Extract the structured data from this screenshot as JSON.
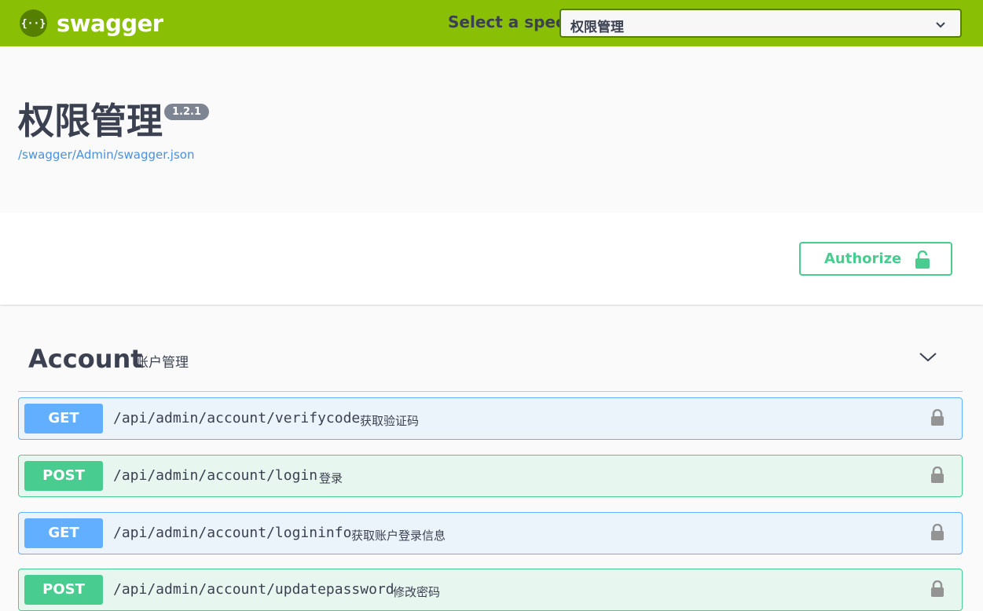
{
  "topbar": {
    "brand": "swagger",
    "spec_label": "Select a spec",
    "spec_selected": "权限管理"
  },
  "info": {
    "title": "权限管理",
    "version": "1.2.1",
    "url": "/swagger/Admin/swagger.json"
  },
  "authorize": {
    "label": "Authorize"
  },
  "tag": {
    "name": "Account",
    "description": "账户管理"
  },
  "operations": [
    {
      "method": "GET",
      "path": "/api/admin/account/verifycode",
      "summary": "获取验证码"
    },
    {
      "method": "POST",
      "path": "/api/admin/account/login",
      "summary": "登录"
    },
    {
      "method": "GET",
      "path": "/api/admin/account/logininfo",
      "summary": "获取账户登录信息"
    },
    {
      "method": "POST",
      "path": "/api/admin/account/updatepassword",
      "summary": "修改密码"
    }
  ],
  "colors": {
    "topbar": "#89bf04",
    "get": "#61affe",
    "post": "#49cc90"
  }
}
